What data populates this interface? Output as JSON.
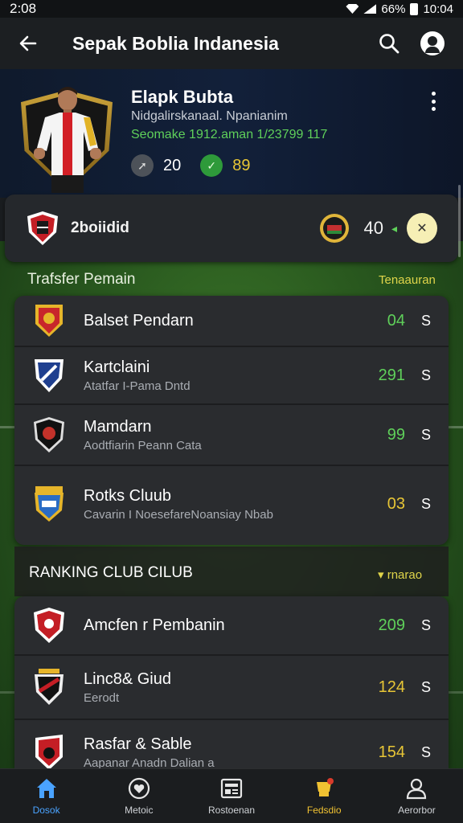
{
  "status_bar": {
    "time_left": "2:08",
    "battery": "66%",
    "time_right": "10:04"
  },
  "app_bar": {
    "title": "Sepak Boblia Indanesia",
    "back_icon": "arrow-left-icon",
    "search_icon": "search-icon",
    "profile_icon": "profile-icon"
  },
  "hero": {
    "name": "Elapk Bubta",
    "subtitle": "Nidgalirskanaal. Npanianim",
    "stat_line": "Seomake 1912.aman 1/23799 117",
    "badges": [
      {
        "icon": "boot-icon",
        "value": "20"
      },
      {
        "icon": "check-icon",
        "value": "89"
      }
    ],
    "colors": {
      "accent_green": "#5fd05a",
      "accent_yellow": "#e8c636"
    }
  },
  "club_card": {
    "name": "2boiidid",
    "score": "40",
    "trend": "up"
  },
  "transfer_section": {
    "title": "Trafsfer Pemain",
    "action": "Tenaauran",
    "rows": [
      {
        "title": "Balset Pendarn",
        "subtitle": "",
        "value": "04",
        "suffix": "S",
        "value_color": "green"
      },
      {
        "title": "Kartclaini",
        "subtitle": "Atatfar I-Pama Dntd",
        "value": "291",
        "suffix": "S",
        "value_color": "green"
      },
      {
        "title": "Mamdarn",
        "subtitle": "Aodtfiarin Peann Cata",
        "value": "99",
        "suffix": "S",
        "value_color": "green"
      },
      {
        "title": "Rotks Cluub",
        "subtitle": "Cavarin I NoesefareNoansiay Nbab",
        "value": "03",
        "suffix": "S",
        "value_color": "yellow"
      }
    ]
  },
  "ranking_section": {
    "title": "RANKING CLUB CILUB",
    "action": "rnarao",
    "rows": [
      {
        "title": "Amcfen r Pembanin",
        "subtitle": "",
        "value": "209",
        "suffix": "S",
        "value_color": "green"
      },
      {
        "title": "Linc8& Giud",
        "subtitle": "Eerodt",
        "value": "124",
        "suffix": "S",
        "value_color": "yellow"
      },
      {
        "title": "Rasfar & Sable",
        "subtitle": "Aapanar Anadn Dalian a",
        "value": "154",
        "suffix": "S",
        "value_color": "yellow"
      }
    ]
  },
  "bottom_nav": [
    {
      "label": "Dosok",
      "icon": "home-icon",
      "state": "active"
    },
    {
      "label": "Metoic",
      "icon": "heart-icon",
      "state": ""
    },
    {
      "label": "Rostoenan",
      "icon": "news-icon",
      "state": ""
    },
    {
      "label": "Fedsdio",
      "icon": "trophy-icon",
      "state": "gold"
    },
    {
      "label": "Aerorbor",
      "icon": "user-icon",
      "state": ""
    }
  ]
}
